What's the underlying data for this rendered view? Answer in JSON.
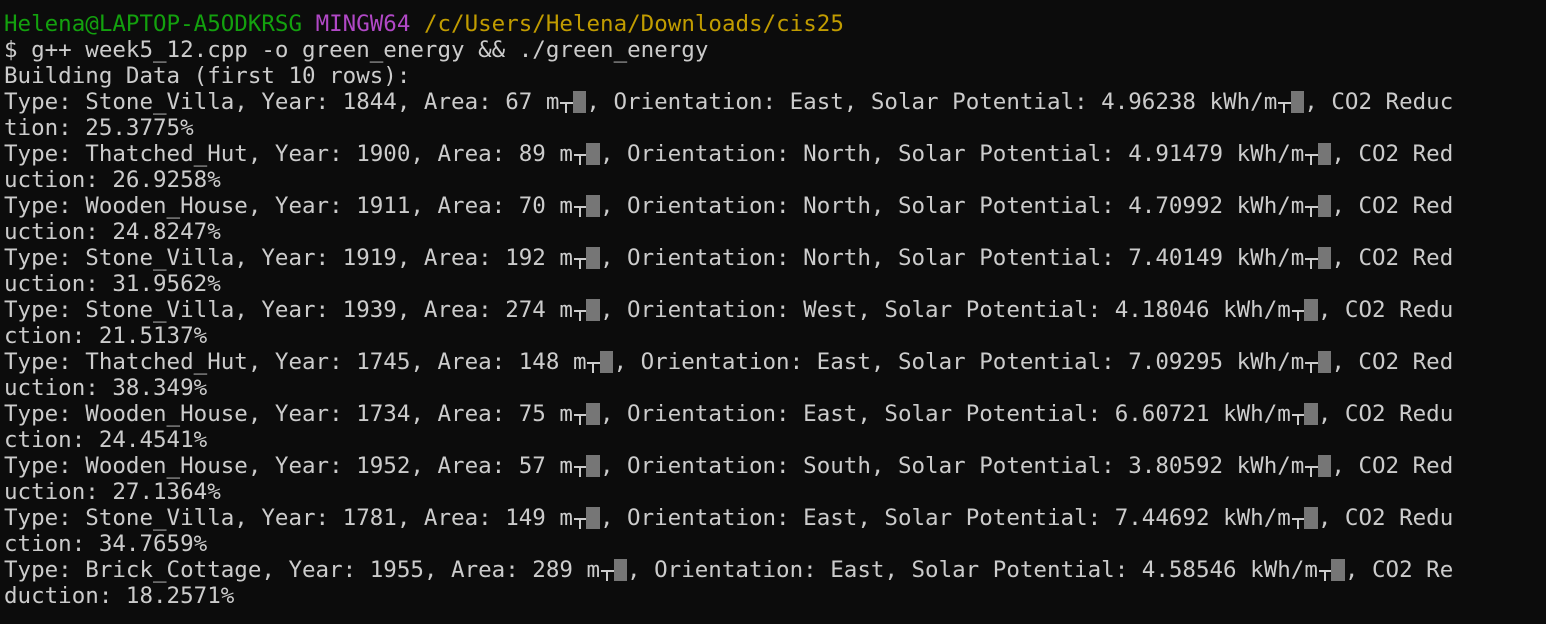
{
  "prompt": {
    "user_host": "Helena@LAPTOP-A5ODKRSG",
    "system": "MINGW64",
    "cwd": "/c/Users/Helena/Downloads/cis25"
  },
  "command": "$ g++ week5_12.cpp -o green_energy && ./green_energy",
  "output_header": "Building Data (first 10 rows):",
  "records": [
    {
      "l1a": "Type: Stone_Villa, Year: 1844, Area: 67 m",
      "l1b": ", Orientation: East, Solar Potential: 4.96238 kWh/m",
      "l1c": ", CO2 Reduc",
      "l2": "tion: 25.3775%"
    },
    {
      "l1a": "Type: Thatched_Hut, Year: 1900, Area: 89 m",
      "l1b": ", Orientation: North, Solar Potential: 4.91479 kWh/m",
      "l1c": ", CO2 Red",
      "l2": "uction: 26.9258%"
    },
    {
      "l1a": "Type: Wooden_House, Year: 1911, Area: 70 m",
      "l1b": ", Orientation: North, Solar Potential: 4.70992 kWh/m",
      "l1c": ", CO2 Red",
      "l2": "uction: 24.8247%"
    },
    {
      "l1a": "Type: Stone_Villa, Year: 1919, Area: 192 m",
      "l1b": ", Orientation: North, Solar Potential: 7.40149 kWh/m",
      "l1c": ", CO2 Red",
      "l2": "uction: 31.9562%"
    },
    {
      "l1a": "Type: Stone_Villa, Year: 1939, Area: 274 m",
      "l1b": ", Orientation: West, Solar Potential: 4.18046 kWh/m",
      "l1c": ", CO2 Redu",
      "l2": "ction: 21.5137%"
    },
    {
      "l1a": "Type: Thatched_Hut, Year: 1745, Area: 148 m",
      "l1b": ", Orientation: East, Solar Potential: 7.09295 kWh/m",
      "l1c": ", CO2 Red",
      "l2": "uction: 38.349%"
    },
    {
      "l1a": "Type: Wooden_House, Year: 1734, Area: 75 m",
      "l1b": ", Orientation: East, Solar Potential: 6.60721 kWh/m",
      "l1c": ", CO2 Redu",
      "l2": "ction: 24.4541%"
    },
    {
      "l1a": "Type: Wooden_House, Year: 1952, Area: 57 m",
      "l1b": ", Orientation: South, Solar Potential: 3.80592 kWh/m",
      "l1c": ", CO2 Red",
      "l2": "uction: 27.1364%"
    },
    {
      "l1a": "Type: Stone_Villa, Year: 1781, Area: 149 m",
      "l1b": ", Orientation: East, Solar Potential: 7.44692 kWh/m",
      "l1c": ", CO2 Redu",
      "l2": "ction: 34.7659%"
    },
    {
      "l1a": "Type: Brick_Cottage, Year: 1955, Area: 289 m",
      "l1b": ", Orientation: East, Solar Potential: 4.58546 kWh/m",
      "l1c": ", CO2 Re",
      "l2": "duction: 18.2571%"
    }
  ],
  "colors": {
    "background": "#0c0c0c",
    "text": "#cccccc",
    "user_host": "#13a10e",
    "system": "#b148c6",
    "cwd": "#c19c00"
  },
  "icons": {
    "mis_encoded_char": "box-drawing-glyph",
    "replacement_char": "gray-block"
  }
}
